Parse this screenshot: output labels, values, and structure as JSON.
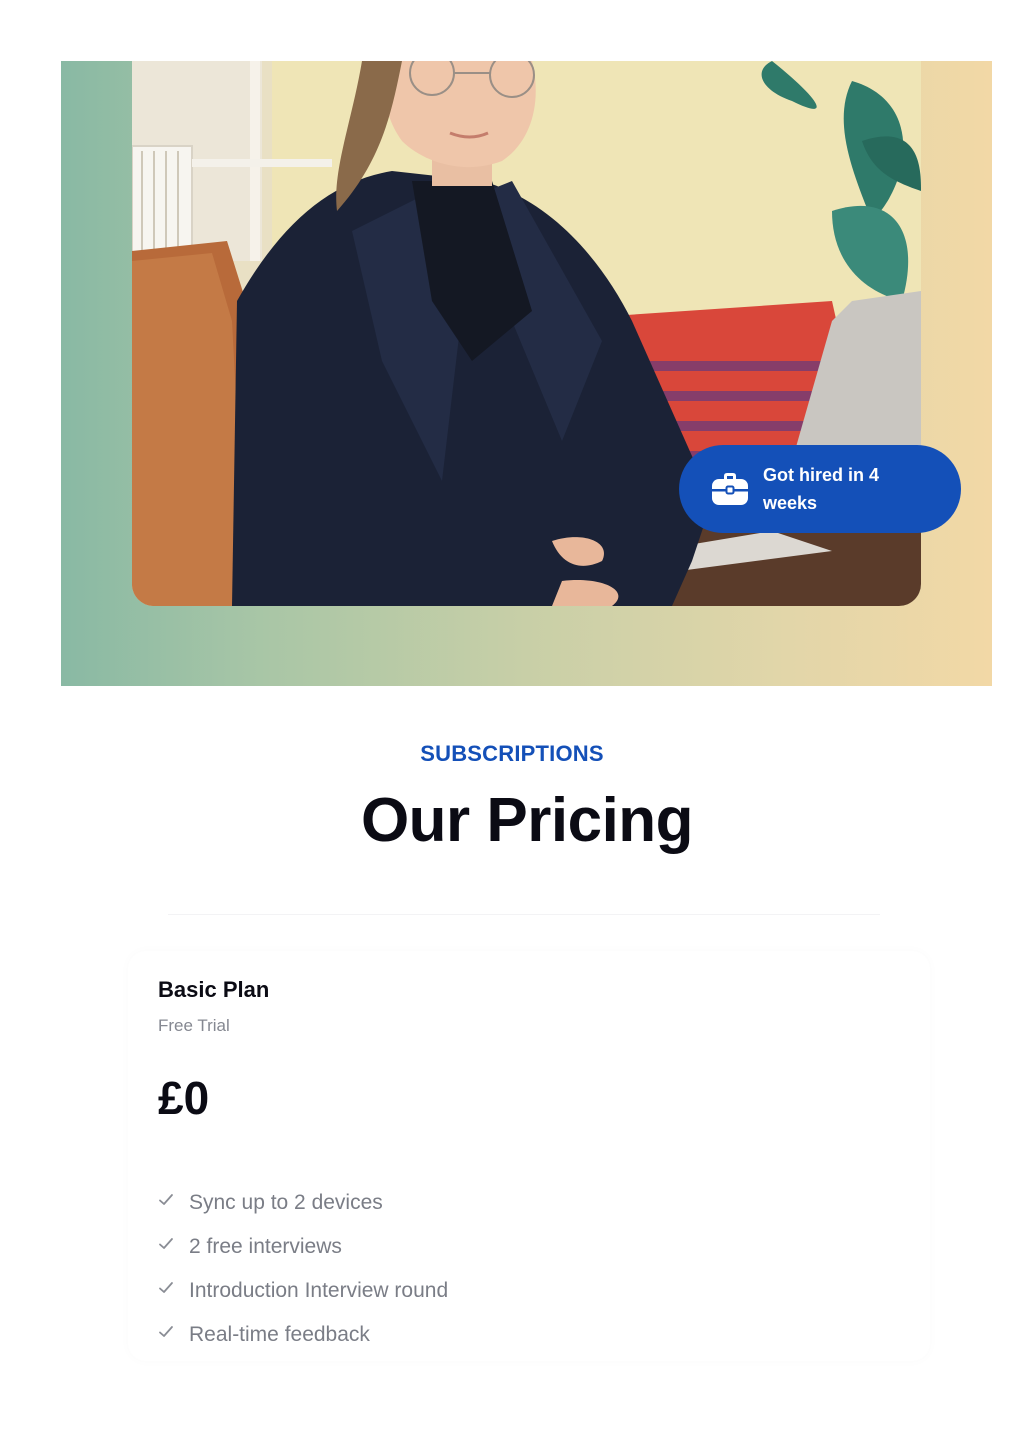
{
  "hero": {
    "badge_text": "Got hired in 4 weeks",
    "badge_icon": "briefcase-icon",
    "badge_color": "#1450b8"
  },
  "section": {
    "eyebrow": "SUBSCRIPTIONS",
    "title": "Our Pricing"
  },
  "plan": {
    "name": "Basic Plan",
    "subtitle": "Free Trial",
    "price": "£0",
    "features": [
      "Sync up to 2 devices",
      "2 free interviews",
      "Introduction Interview round",
      "Real-time feedback"
    ]
  },
  "colors": {
    "accent": "#1450b8",
    "heading": "#0b0b14",
    "muted": "#7a7d86"
  }
}
